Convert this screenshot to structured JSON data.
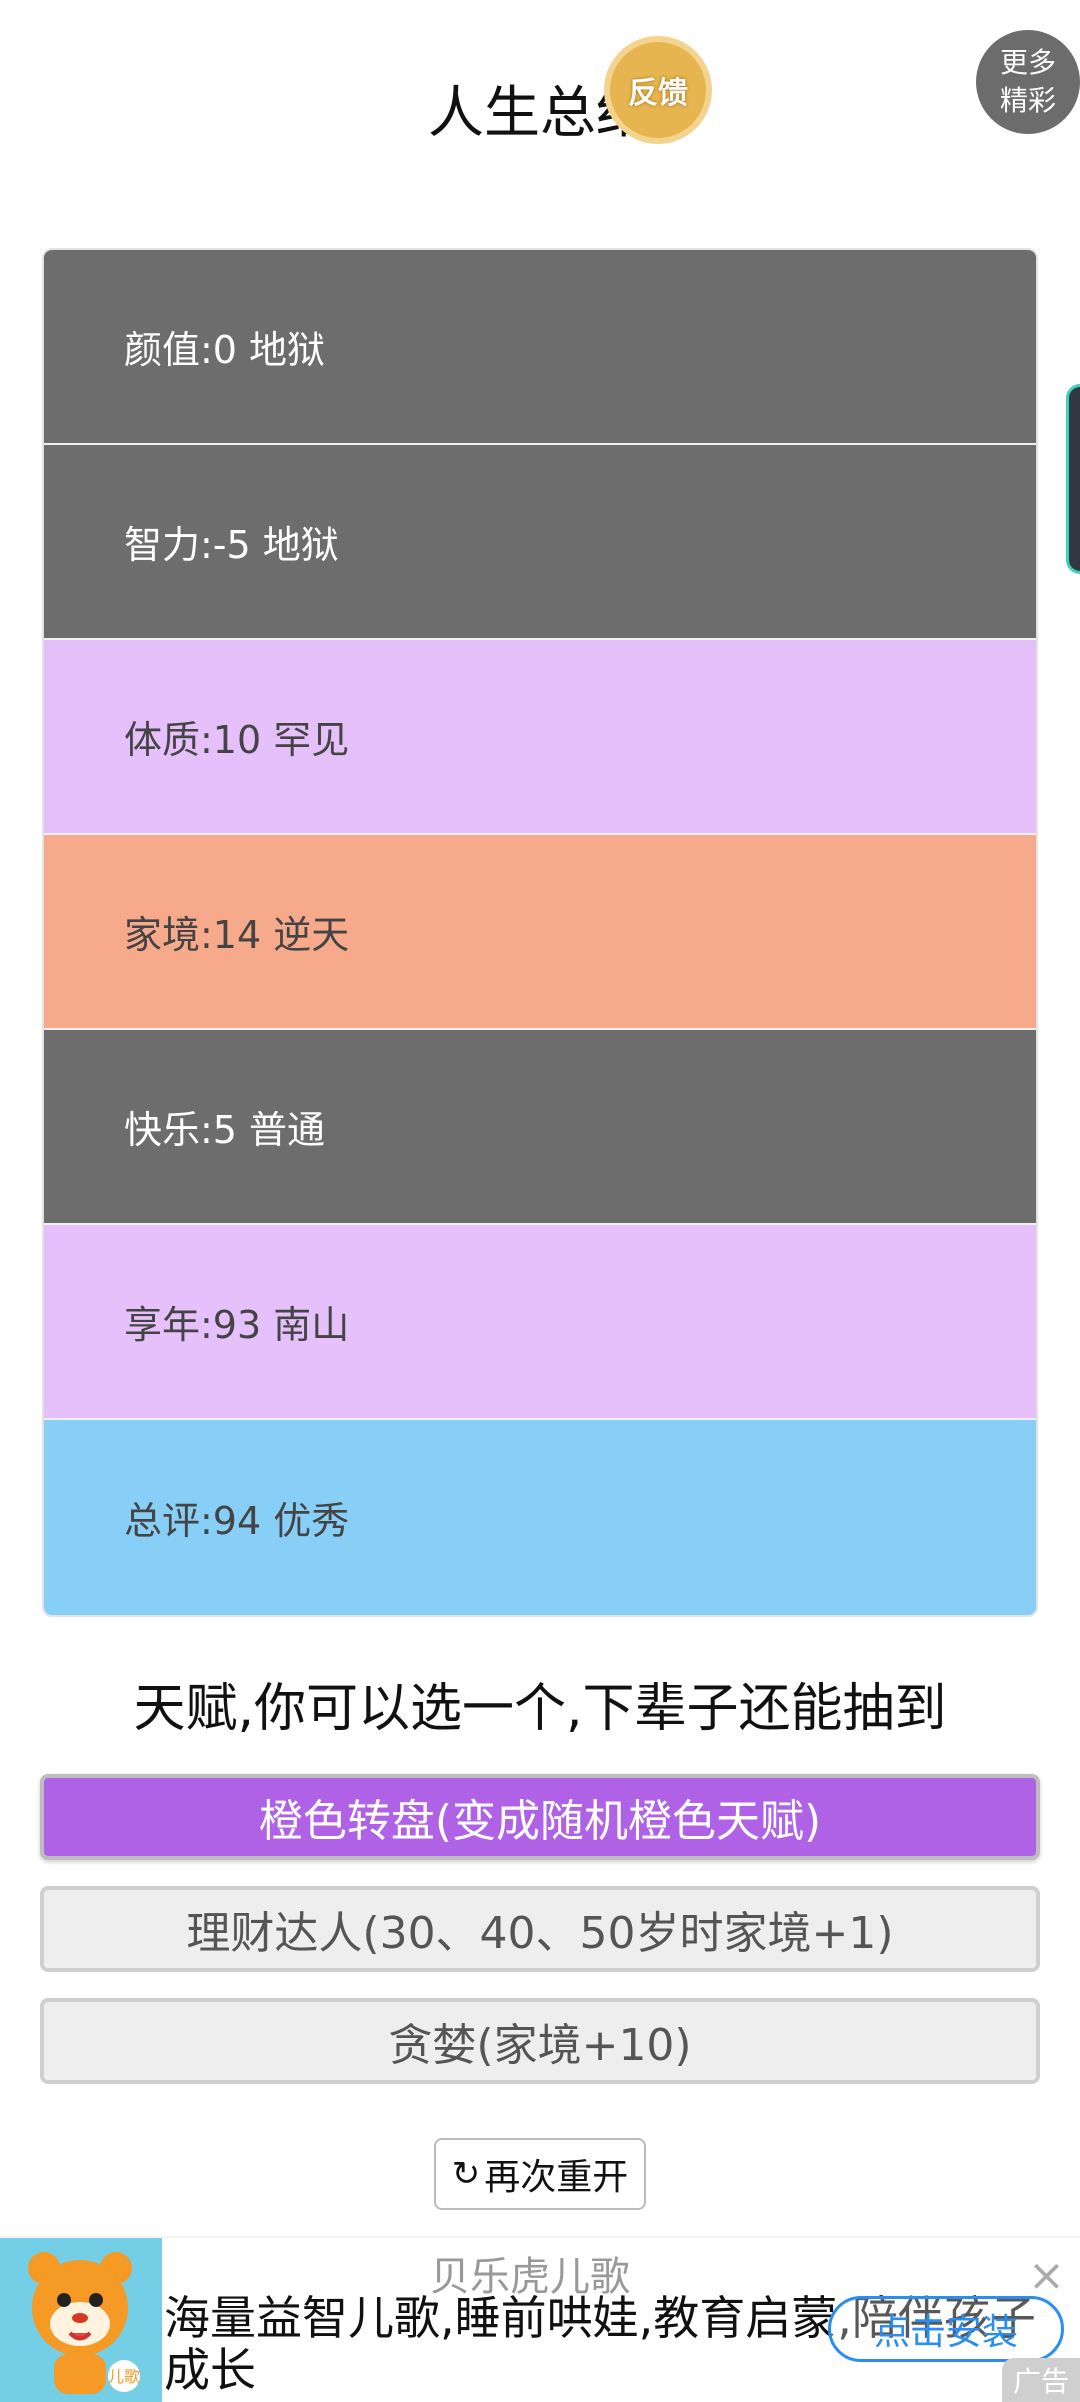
{
  "header": {
    "title": "人生总结",
    "feedback_label": "反馈",
    "more_line1": "更多",
    "more_line2": "精彩"
  },
  "stats": [
    {
      "label": "颜值:0 地狱",
      "color": "#6d6d6d"
    },
    {
      "label": "智力:-5 地狱",
      "color": "#6d6d6d"
    },
    {
      "label": "体质:10 罕见",
      "color": "#e5c0fb"
    },
    {
      "label": "家境:14 逆天",
      "color": "#f7a98b"
    },
    {
      "label": "快乐:5 普通",
      "color": "#6d6d6d"
    },
    {
      "label": "享年:93 南山",
      "color": "#e5c0fb"
    },
    {
      "label": "总评:94 优秀",
      "color": "#88cff8"
    }
  ],
  "talents": {
    "heading": "天赋,你可以选一个,下辈子还能抽到",
    "options": [
      {
        "label": "橙色转盘(变成随机橙色天赋)",
        "selected": true
      },
      {
        "label": "理财达人(30、40、50岁时家境+1)",
        "selected": false
      },
      {
        "label": "贪婪(家境+10)",
        "selected": false
      }
    ]
  },
  "restart": {
    "icon": "refresh-icon",
    "label": "再次重开"
  },
  "ad": {
    "logo_badge": "儿歌",
    "title": "贝乐虎儿歌",
    "description": "海量益智儿歌,睡前哄娃,教育启蒙,陪伴孩子成长",
    "cta": "点击安装",
    "close_icon": "close-icon",
    "label": "广告"
  }
}
